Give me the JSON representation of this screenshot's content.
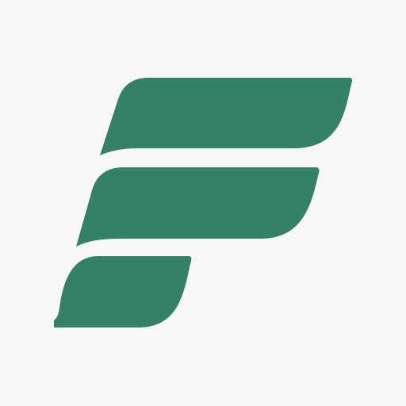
{
  "icon": {
    "name": "f-logo-icon",
    "background_color": "#f7f7f7",
    "mark_color": "#348166"
  }
}
